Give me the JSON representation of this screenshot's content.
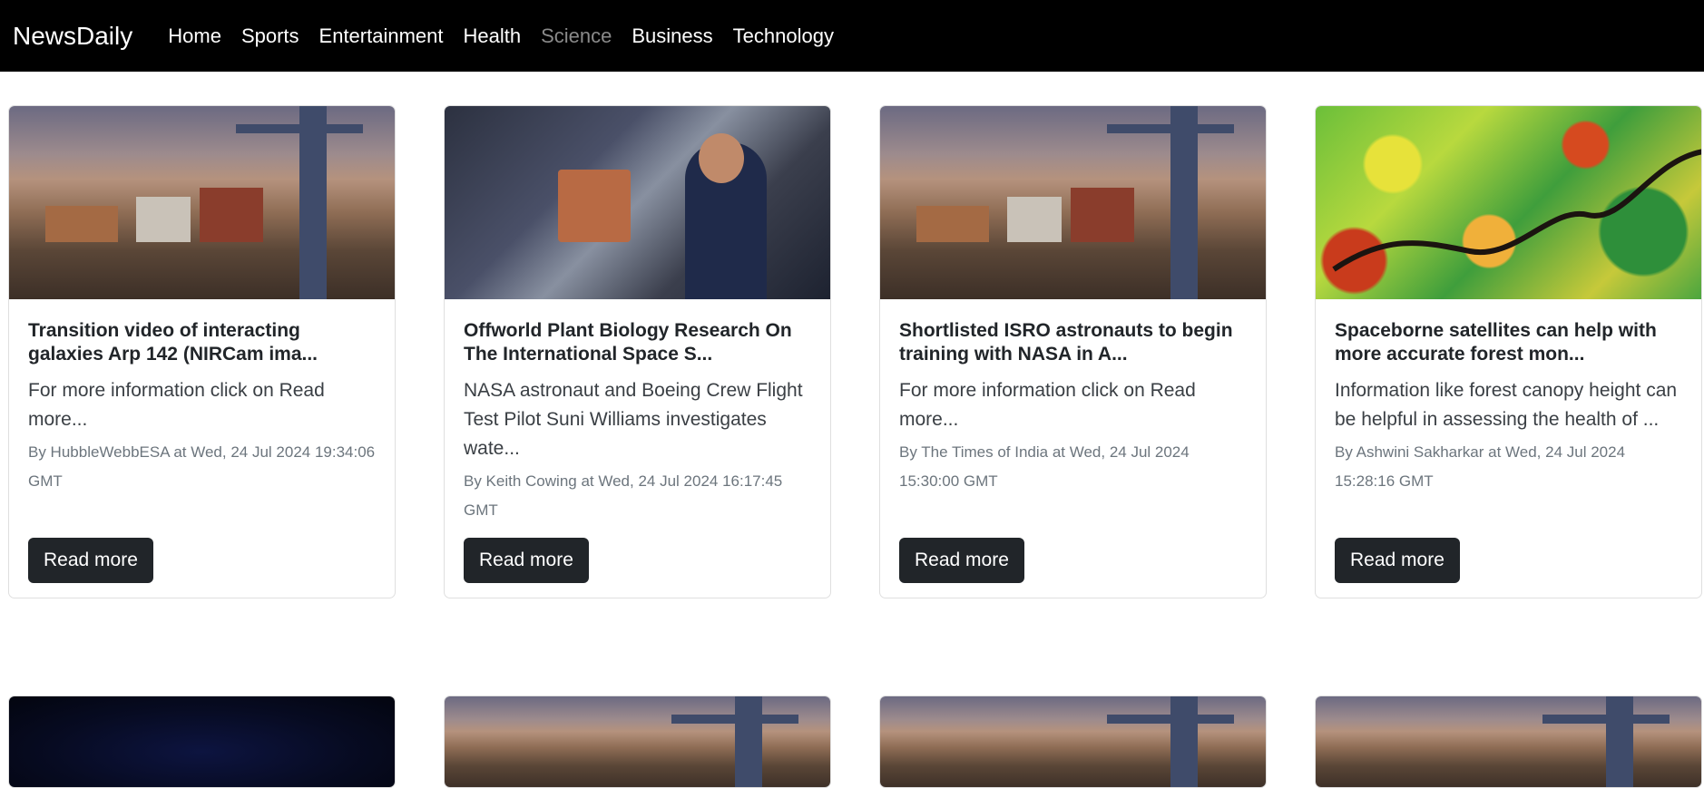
{
  "navbar": {
    "brand": "NewsDaily",
    "links": [
      {
        "label": "Home",
        "active": false
      },
      {
        "label": "Sports",
        "active": false
      },
      {
        "label": "Entertainment",
        "active": false
      },
      {
        "label": "Health",
        "active": false
      },
      {
        "label": "Science",
        "active": true
      },
      {
        "label": "Business",
        "active": false
      },
      {
        "label": "Technology",
        "active": false
      }
    ]
  },
  "articles": [
    {
      "image": "container-port-photo",
      "title": "Transition video of interacting galaxies Arp 142 (NIRCam ima...",
      "description": "For more information click on Read more...",
      "meta": "By HubbleWebbESA at Wed, 24 Jul 2024 19:34:06 GMT",
      "button": "Read more"
    },
    {
      "image": "space-station-astronaut-photo",
      "title": "Offworld Plant Biology Research On The International Space S...",
      "description": "NASA astronaut and Boeing Crew Flight Test Pilot Suni Williams investigates wate...",
      "meta": "By Keith Cowing at Wed, 24 Jul 2024 16:17:45 GMT",
      "button": "Read more"
    },
    {
      "image": "container-port-photo",
      "title": "Shortlisted ISRO astronauts to begin training with NASA in A...",
      "description": "For more information click on Read more...",
      "meta": "By The Times of India at Wed, 24 Jul 2024 15:30:00 GMT",
      "button": "Read more"
    },
    {
      "image": "forest-satellite-map",
      "title": "Spaceborne satellites can help with more accurate forest mon...",
      "description": "Information like forest canopy height can be helpful in assessing the health of ...",
      "meta": "By Ashwini Sakharkar at Wed, 24 Jul 2024 15:28:16 GMT",
      "button": "Read more"
    }
  ],
  "second_row_images": [
    "dark-space-photo",
    "container-port-photo",
    "container-port-photo",
    "container-port-photo"
  ],
  "colors": {
    "navbar_bg": "#000000",
    "nav_disabled": "#8a8a8a",
    "button_bg": "#212529",
    "meta_text": "#6c757d"
  }
}
